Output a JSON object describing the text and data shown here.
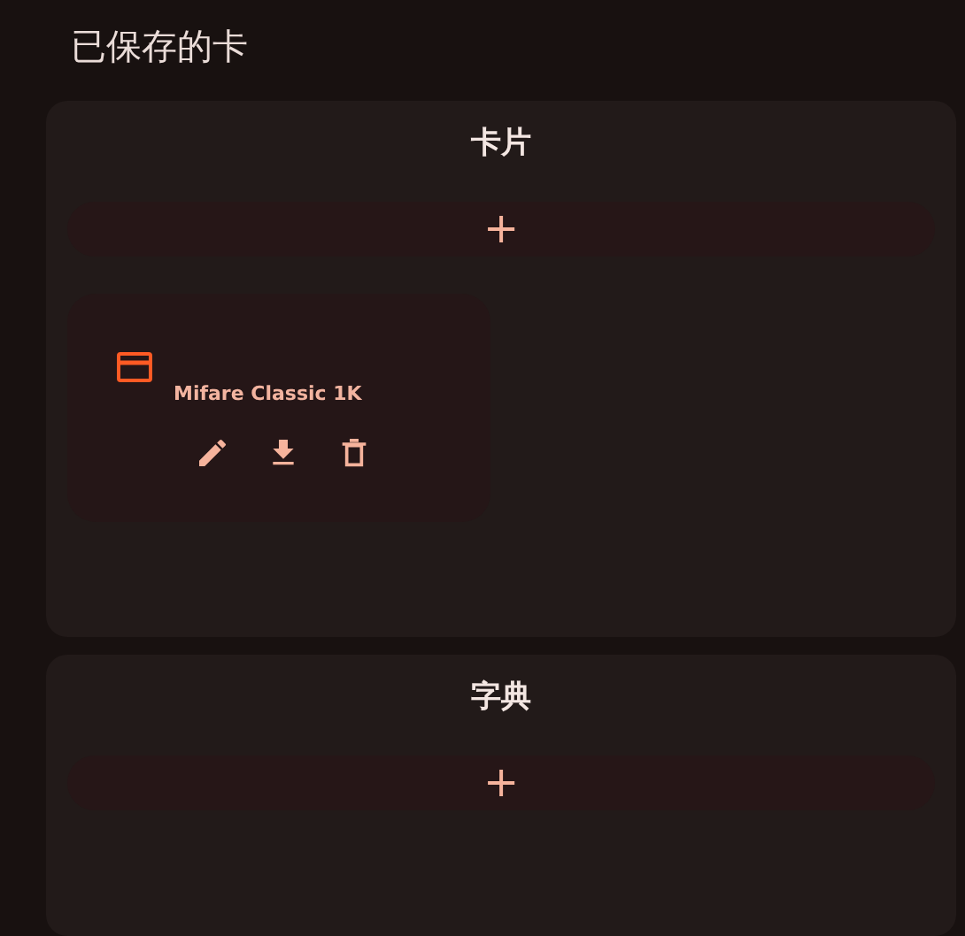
{
  "title": "已保存的卡",
  "sections": [
    {
      "title": "卡片",
      "add_label": "+",
      "cards": [
        {
          "name": "Mifare Classic 1K"
        }
      ]
    },
    {
      "title": "字典",
      "add_label": "+"
    }
  ]
}
